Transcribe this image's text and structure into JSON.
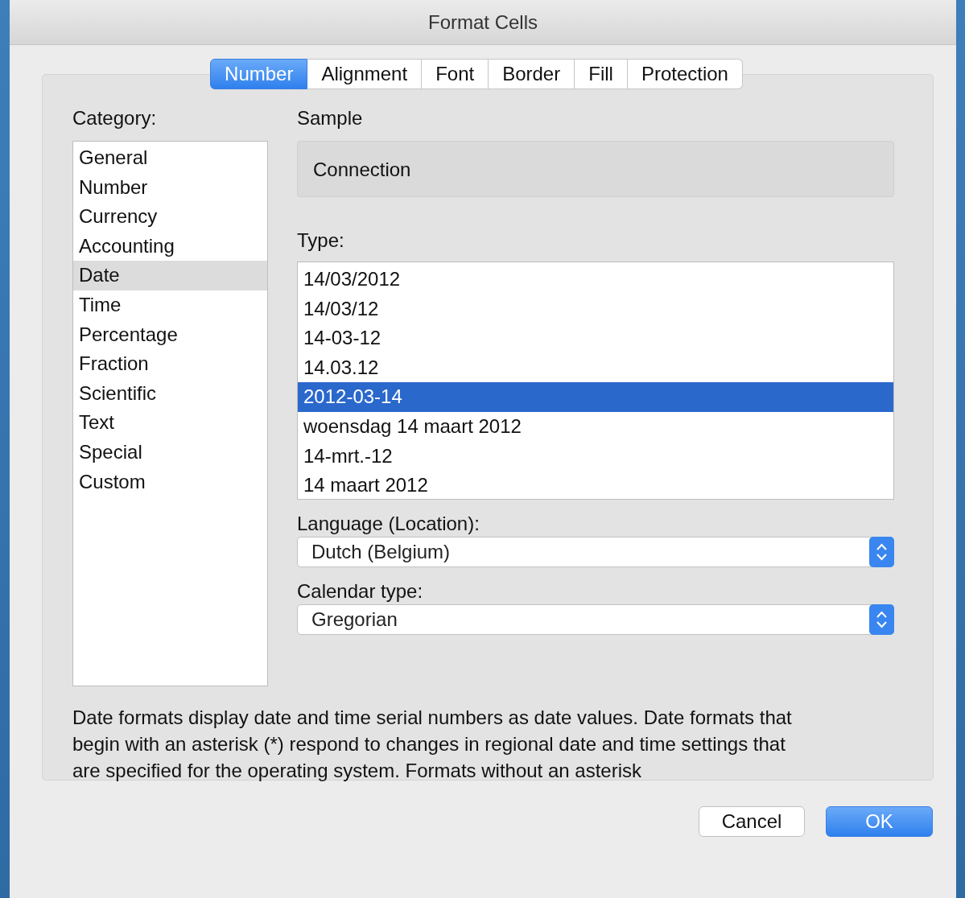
{
  "window": {
    "title": "Format Cells"
  },
  "tabs": [
    {
      "label": "Number",
      "selected": true
    },
    {
      "label": "Alignment",
      "selected": false
    },
    {
      "label": "Font",
      "selected": false
    },
    {
      "label": "Border",
      "selected": false
    },
    {
      "label": "Fill",
      "selected": false
    },
    {
      "label": "Protection",
      "selected": false
    }
  ],
  "category": {
    "label": "Category:",
    "items": [
      {
        "label": "General",
        "selected": false
      },
      {
        "label": "Number",
        "selected": false
      },
      {
        "label": "Currency",
        "selected": false
      },
      {
        "label": "Accounting",
        "selected": false
      },
      {
        "label": "Date",
        "selected": true
      },
      {
        "label": "Time",
        "selected": false
      },
      {
        "label": "Percentage",
        "selected": false
      },
      {
        "label": "Fraction",
        "selected": false
      },
      {
        "label": "Scientific",
        "selected": false
      },
      {
        "label": "Text",
        "selected": false
      },
      {
        "label": "Special",
        "selected": false
      },
      {
        "label": "Custom",
        "selected": false
      }
    ]
  },
  "sample": {
    "label": "Sample",
    "value": "Connection"
  },
  "type": {
    "label": "Type:",
    "items": [
      {
        "label": "14/03/2012",
        "selected": false
      },
      {
        "label": "14/03/12",
        "selected": false
      },
      {
        "label": "14-03-12",
        "selected": false
      },
      {
        "label": "14.03.12",
        "selected": false
      },
      {
        "label": "2012-03-14",
        "selected": true
      },
      {
        "label": "woensdag 14 maart 2012",
        "selected": false
      },
      {
        "label": "14-mrt.-12",
        "selected": false
      },
      {
        "label": "14 maart 2012",
        "selected": false
      }
    ]
  },
  "language": {
    "label": "Language (Location):",
    "value": "Dutch (Belgium)"
  },
  "calendar": {
    "label": "Calendar type:",
    "value": "Gregorian"
  },
  "description": "Date formats display date and time serial numbers as date values.  Date formats that begin with an asterisk (*) respond to changes in regional date and time settings that are specified for the operating system. Formats without an asterisk",
  "buttons": [
    {
      "label": "Cancel",
      "kind": "normal"
    },
    {
      "label": "OK",
      "kind": "default"
    }
  ]
}
